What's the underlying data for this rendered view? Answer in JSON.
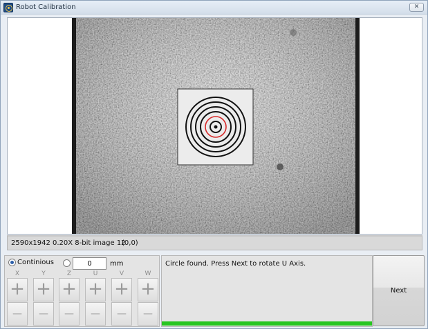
{
  "window": {
    "title": "Robot Calibration",
    "close_glyph": "✕"
  },
  "status": {
    "image_info": "2590x1942 0.20X 8-bit image 12",
    "coordinates": "(0,0)"
  },
  "jog": {
    "mode_continuous_label": "Continious",
    "mode_continuous_selected": true,
    "step_value": "0",
    "unit": "mm",
    "axes": [
      "X",
      "Y",
      "Z",
      "U",
      "V",
      "W"
    ],
    "plus_glyph": "+",
    "minus_glyph": "—"
  },
  "message": {
    "text": "Circle found. Press Next to rotate U Axis.",
    "progress_fraction": 1.0
  },
  "buttons": {
    "next_label": "Next"
  },
  "colors": {
    "progress": "#27c521",
    "target_highlight": "#d62828"
  }
}
